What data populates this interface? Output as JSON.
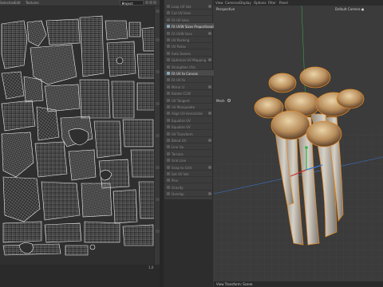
{
  "uv_editor": {
    "menus": [
      "Selection",
      "Edit",
      "Textures"
    ],
    "project_value": "Project",
    "coord_value": "1,0"
  },
  "tools": [
    {
      "label": "Loop UV Isle",
      "highlight": false
    },
    {
      "label": "Cut UV Isles",
      "highlight": false
    },
    {
      "label": "Fit UV Isles",
      "highlight": false
    },
    {
      "label": "Fit UVW Sizes Proportional",
      "highlight": true
    },
    {
      "label": "Fit UVW Isles",
      "highlight": false
    },
    {
      "label": "UV Packing",
      "highlight": false
    },
    {
      "label": "UV Relax",
      "highlight": false
    },
    {
      "label": "Auto Seams",
      "highlight": false
    },
    {
      "label": "Optimize UV Mapping",
      "highlight": false
    },
    {
      "label": "Straighten UVs",
      "highlight": false
    },
    {
      "label": "Fit UV to Canvas",
      "highlight": true
    },
    {
      "label": "Fit UV to",
      "highlight": false
    },
    {
      "label": "Mirror U",
      "highlight": false
    },
    {
      "label": "Rotate CCW",
      "highlight": false
    },
    {
      "label": "UV Tangent",
      "highlight": false
    },
    {
      "label": "UV Manipulate",
      "highlight": false
    },
    {
      "label": "Align UV Horizontal",
      "highlight": false
    },
    {
      "label": "Equalize UV",
      "highlight": false
    },
    {
      "label": "Equalize UV",
      "highlight": false
    },
    {
      "label": "UV Transform",
      "highlight": false
    },
    {
      "label": "Blend UV",
      "highlight": false
    },
    {
      "label": "Line Up",
      "highlight": false
    },
    {
      "label": "Terrace",
      "highlight": false
    },
    {
      "label": "Grid Line",
      "highlight": false
    },
    {
      "label": "Snap to Grid",
      "highlight": false
    },
    {
      "label": "Set UV Isle",
      "highlight": false
    },
    {
      "label": "Pins",
      "highlight": false
    },
    {
      "label": "Gravity",
      "highlight": false
    },
    {
      "label": "Overlap",
      "highlight": false
    }
  ],
  "viewport": {
    "menus": [
      "View",
      "Cameras",
      "Display",
      "Options",
      "Filter",
      "Panel"
    ],
    "projection": "Perspective",
    "camera": "Default Camera ●",
    "mesh_label": "Mesh",
    "status": "View Transform: Scene",
    "icons": [
      "move-icon",
      "zoom-icon",
      "rotate-icon",
      "maximize-icon"
    ]
  },
  "colors": {
    "uv_bg": "#2f2f2f",
    "uv_lines": "#e6e6e6",
    "viewport_bg": "#3b3b3b",
    "selection_orange": "#e08a2a",
    "cap_brown": "#6b4a2e",
    "cap_light": "#d8bb8c",
    "stem": "#bfb7ab",
    "axis_x": "#c83030",
    "axis_y": "#2fb84a",
    "axis_z": "#3a78d0"
  }
}
